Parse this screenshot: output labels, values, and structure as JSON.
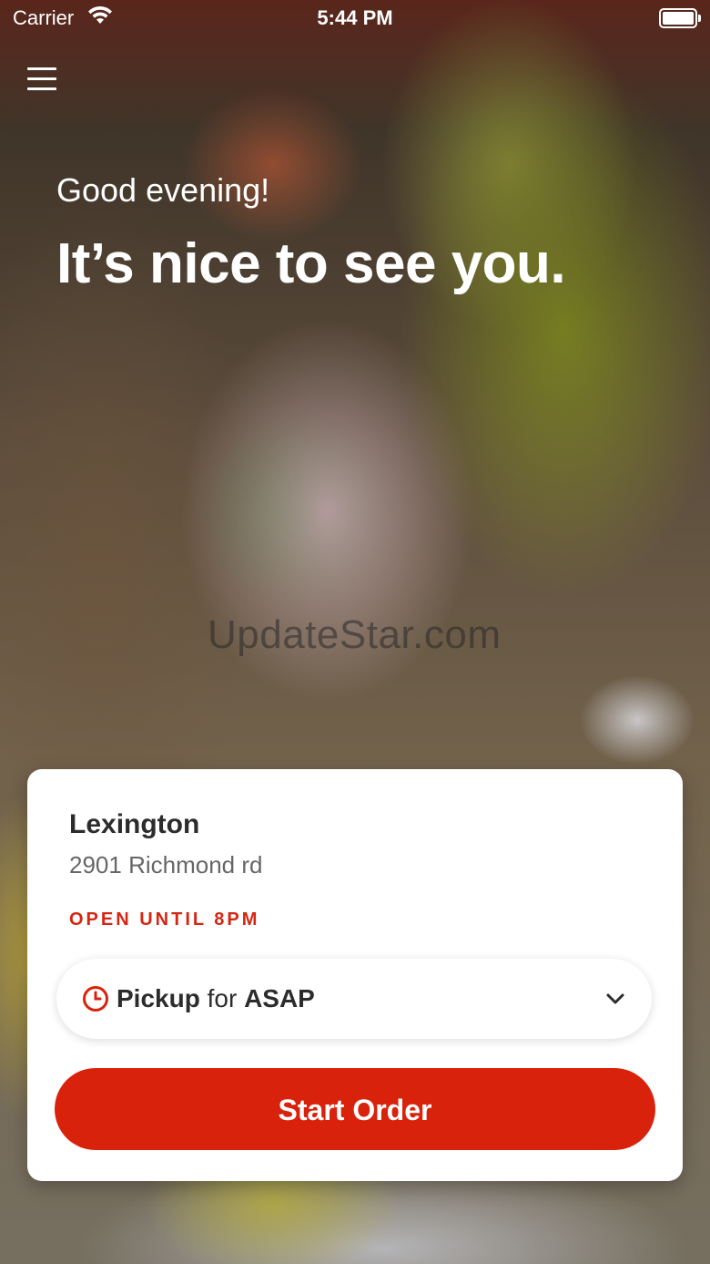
{
  "status_bar": {
    "carrier": "Carrier",
    "time": "5:44 PM",
    "icons": [
      "wifi-icon",
      "battery-icon"
    ]
  },
  "header": {
    "menu_icon": "hamburger-menu-icon",
    "greeting": "Good evening!",
    "headline": "It’s nice to see you."
  },
  "watermark": "UpdateStar.com",
  "location_card": {
    "name": "Lexington",
    "address": "2901 Richmond rd",
    "hours": "OPEN UNTIL 8PM",
    "order_mode": {
      "icon": "clock-icon",
      "mode": "Pickup",
      "connector": "for",
      "time": "ASAP",
      "dropdown_icon": "chevron-down-icon"
    },
    "start_button_label": "Start Order"
  },
  "colors": {
    "accent": "#d9220c",
    "hours_text": "#d42612",
    "card_bg": "#ffffff",
    "title_text": "#2c2c2c",
    "subtitle_text": "#666666"
  }
}
